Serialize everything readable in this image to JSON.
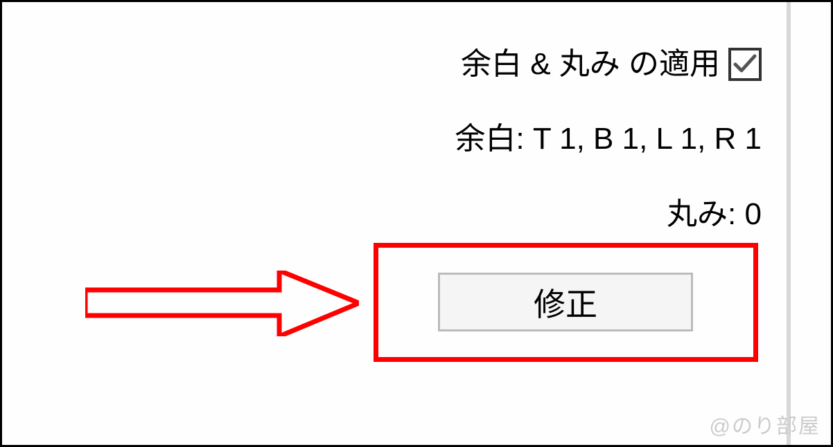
{
  "settings": {
    "apply_margin_round_label": "余白 & 丸み の適用",
    "apply_checked": true,
    "margin_label": "余白:",
    "margin_value": "T 1, B 1, L 1, R 1",
    "round_label": "丸み:",
    "round_value": "0"
  },
  "button": {
    "modify_label": "修正"
  },
  "watermark": "@のり部屋",
  "annotation": {
    "highlight_color": "#ff0000",
    "arrow_color": "#ff0000"
  }
}
